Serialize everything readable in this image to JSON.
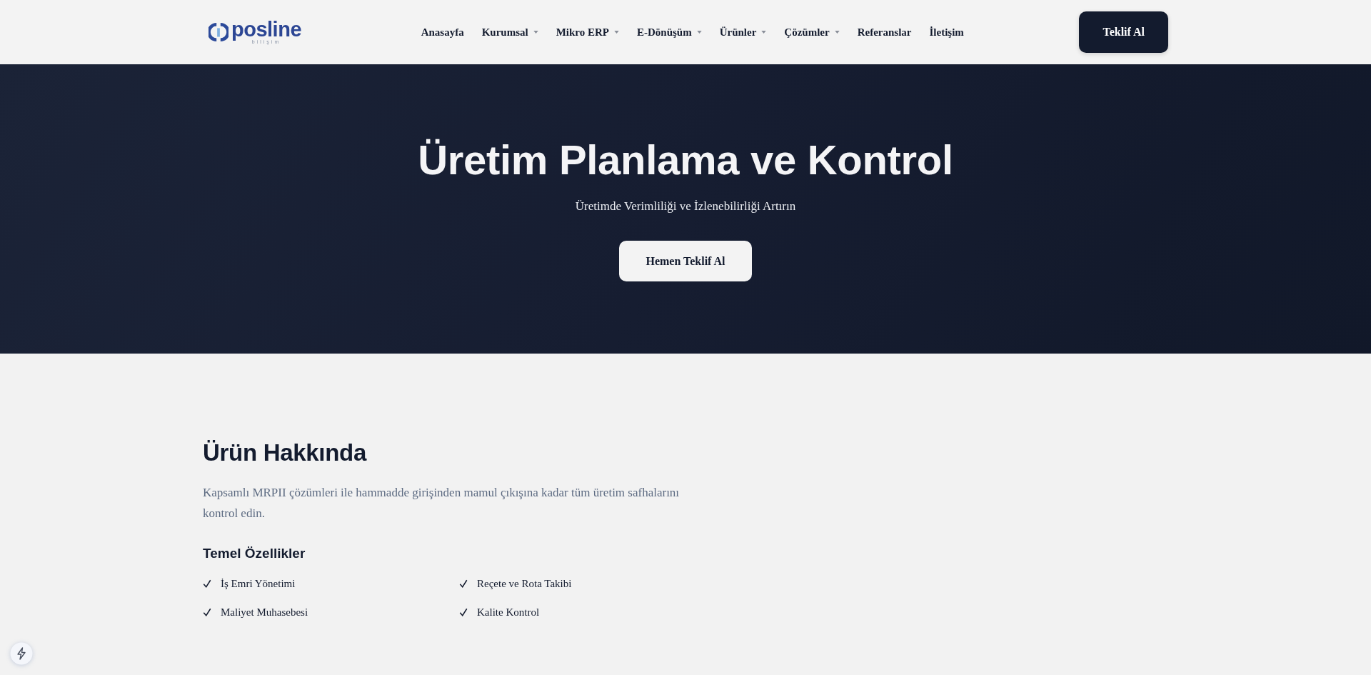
{
  "header": {
    "logo": {
      "wordmark": "posline",
      "tagline": "bilişim"
    },
    "nav": [
      {
        "label": "Anasayfa",
        "dropdown": false
      },
      {
        "label": "Kurumsal",
        "dropdown": true
      },
      {
        "label": "Mikro ERP",
        "dropdown": true
      },
      {
        "label": "E-Dönüşüm",
        "dropdown": true
      },
      {
        "label": "Ürünler",
        "dropdown": true
      },
      {
        "label": "Çözümler",
        "dropdown": true
      },
      {
        "label": "Referanslar",
        "dropdown": false
      },
      {
        "label": "İletişim",
        "dropdown": false
      }
    ],
    "cta": "Teklif Al"
  },
  "hero": {
    "title": "Üretim Planlama ve Kontrol",
    "subtitle": "Üretimde Verimliliği ve İzlenebilirliği Artırın",
    "button": "Hemen Teklif Al"
  },
  "about": {
    "title": "Ürün Hakkında",
    "description": "Kapsamlı MRPII çözümleri ile hammadde girişinden mamul çıkışına kadar tüm üretim safhalarını kontrol edin.",
    "features_title": "Temel Özellikler",
    "features": [
      "İş Emri Yönetimi",
      "Reçete ve Rota Takibi",
      "Maliyet Muhasebesi",
      "Kalite Kontrol"
    ]
  }
}
